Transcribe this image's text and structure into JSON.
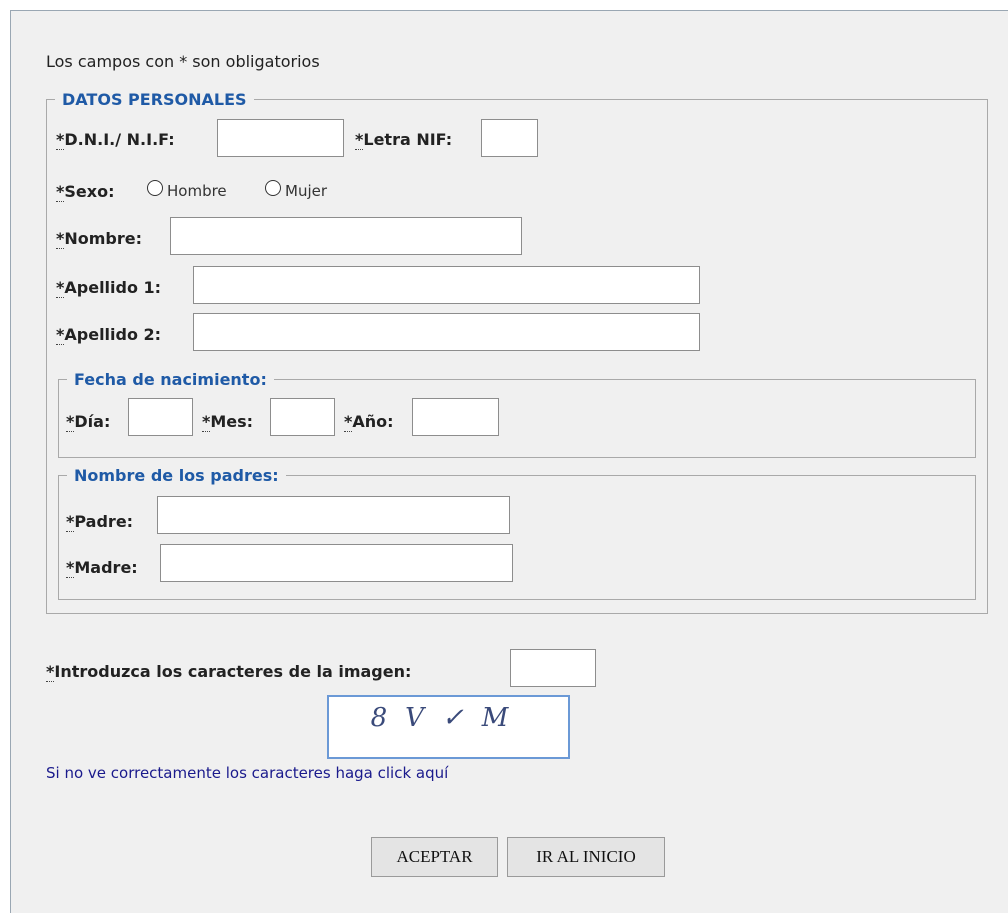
{
  "notice": "Los campos con * son obligatorios",
  "sections": {
    "personal": "DATOS PERSONALES",
    "birthdate": "Fecha de nacimiento:",
    "parents": "Nombre de los padres:"
  },
  "fields": {
    "dni_label": "D.N.I./ N.I.F:",
    "letra_label": "Letra NIF:",
    "sexo_label": "Sexo:",
    "hombre": "Hombre",
    "mujer": "Mujer",
    "nombre_label": "Nombre:",
    "apellido1_label": "Apellido 1:",
    "apellido2_label": "Apellido 2:",
    "dia_label": "Día:",
    "mes_label": "Mes:",
    "anio_label": "Año:",
    "padre_label": "Padre:",
    "madre_label": "Madre:",
    "required_mark": "*"
  },
  "captcha": {
    "label": "Introduzca los caracteres de la imagen:",
    "image_text": "8V✓M",
    "reload_link": "Si no ve correctamente los caracteres haga click aquí"
  },
  "buttons": {
    "accept": "ACEPTAR",
    "home": "IR AL INICIO"
  },
  "colors": {
    "legend": "#1f5aa6",
    "link": "#1a1a8c",
    "panel_bg": "#f0f0f0"
  }
}
